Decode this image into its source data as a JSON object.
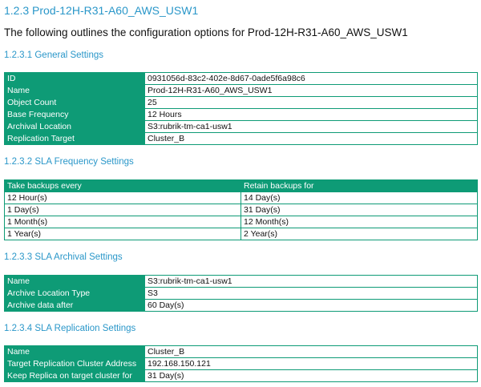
{
  "section": {
    "title": "1.2.3 Prod-12H-R31-A60_AWS_USW1",
    "intro": "The following outlines the configuration options for Prod-12H-R31-A60_AWS_USW1"
  },
  "general": {
    "title": "1.2.3.1 General Settings",
    "rows": [
      {
        "label": "ID",
        "value": "0931056d-83c2-402e-8d67-0ade5f6a98c6"
      },
      {
        "label": "Name",
        "value": "Prod-12H-R31-A60_AWS_USW1"
      },
      {
        "label": "Object Count",
        "value": "25"
      },
      {
        "label": "Base Frequency",
        "value": "12 Hours"
      },
      {
        "label": "Archival Location",
        "value": "S3:rubrik-tm-ca1-usw1"
      },
      {
        "label": "Replication Target",
        "value": "Cluster_B"
      }
    ]
  },
  "frequency": {
    "title": "1.2.3.2 SLA Frequency Settings",
    "headers": [
      "Take backups every",
      "Retain backups for"
    ],
    "rows": [
      [
        "12 Hour(s)",
        "14 Day(s)"
      ],
      [
        "1 Day(s)",
        "31 Day(s)"
      ],
      [
        "1 Month(s)",
        "12 Month(s)"
      ],
      [
        "1 Year(s)",
        "2 Year(s)"
      ]
    ]
  },
  "archival": {
    "title": "1.2.3.3 SLA Archival Settings",
    "rows": [
      {
        "label": "Name",
        "value": "S3:rubrik-tm-ca1-usw1"
      },
      {
        "label": "Archive Location Type",
        "value": "S3"
      },
      {
        "label": "Archive data after",
        "value": "60 Day(s)"
      }
    ]
  },
  "replication": {
    "title": "1.2.3.4 SLA Replication Settings",
    "rows": [
      {
        "label": "Name",
        "value": "Cluster_B"
      },
      {
        "label": "Target Replication Cluster Address",
        "value": "192.168.150.121"
      },
      {
        "label": "Keep Replica on target cluster for",
        "value": "31 Day(s)"
      }
    ]
  },
  "colors": {
    "accent_green": "#0e9b76",
    "heading_blue": "#2a97c9"
  }
}
